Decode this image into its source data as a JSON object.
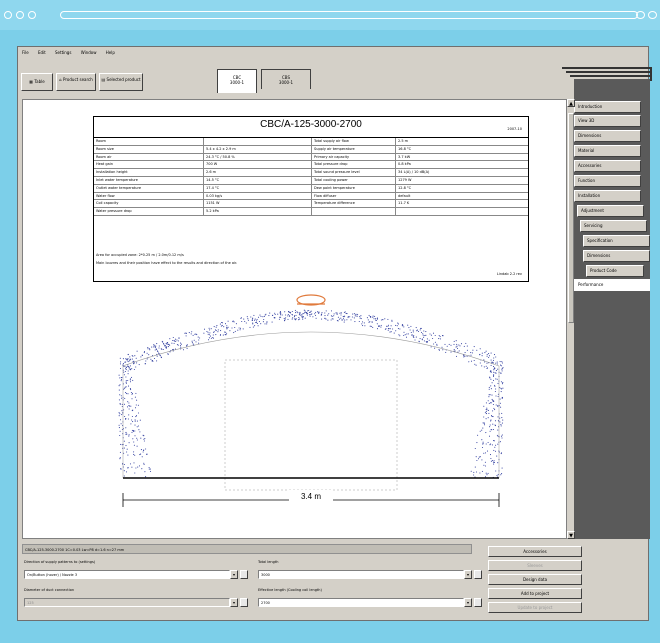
{
  "window": {
    "menu": [
      "File",
      "Edit",
      "Settings",
      "Window",
      "Help"
    ],
    "tool_buttons": [
      {
        "label": "Table",
        "icon": "table-icon"
      },
      {
        "label": "Product search",
        "icon": "house-icon"
      },
      {
        "label": "Selected product",
        "icon": "document-icon"
      }
    ],
    "doc_tabs": [
      {
        "line1": "CBC",
        "line2": "3000-1"
      },
      {
        "line1": "CBS",
        "line2": "3000-1"
      }
    ]
  },
  "side_tabs": [
    "Introduction",
    "View 3D",
    "Dimensions",
    "Material",
    "Accessories",
    "Function",
    "Installation",
    "Adjustment",
    "Servicing",
    "Specification",
    "Dimensions",
    "Product Code",
    "Performance"
  ],
  "document": {
    "title": "CBC/A-125-3000-2700",
    "title_right": "2007-10",
    "rows": [
      [
        "Room",
        "",
        "Total supply air flow",
        "2.5 m"
      ],
      [
        "Room size",
        "5.4 x 4.2 x 2.9 m",
        "Supply air temperature",
        "16.8 °C"
      ],
      [
        "Room air",
        "24.3 °C / 50.8 %",
        "Primary air capacity",
        "3.7 kW"
      ],
      [
        "Heat gain",
        "700 W",
        "Total pressure drop",
        "0.8 kPa"
      ],
      [
        "Installation height",
        "2.6 m",
        "Total sound pressure level",
        "34 L(A) / 10 dB(A)"
      ],
      [
        "Inlet water temperature",
        "14.5 °C",
        "Total cooling power",
        "1279 W"
      ],
      [
        "Outlet water temperature",
        "17.4 °C",
        "Dew point temperature",
        "12.8 °C"
      ],
      [
        "Water flow",
        "0.03 kg/s",
        "Flow diffuser",
        "default"
      ],
      [
        "Coil capacity",
        "1151 W",
        "Temperature difference",
        "11.7 K"
      ],
      [
        "Water pressure drop",
        "5.2 kPa",
        "",
        ""
      ]
    ],
    "notes": [
      "Area for occupied zone: 2*0.25 m / 2.0m/0.12 m/s",
      "Main louvres and their position have effect to the results and direction of the air."
    ],
    "stamp": "Lindab 2.2 rev",
    "dimension_label": "3.4 m"
  },
  "bottom": {
    "status": "CBC/A-125-3000-2700 1C=0.03 Lw=P8 d=1.6 n=27 mm",
    "label_direction": "Direction of supply patterns to (settings)",
    "value_direction": "On/Button (hover) / Nozzle 3",
    "label_length": "Total length",
    "value_length": "3000",
    "label_connection": "Diameter of duct connection",
    "value_connection": "125",
    "label_effective": "Effective length (Cooling coil length)",
    "value_effective": "2700",
    "actions": [
      {
        "label": "Accessories",
        "enabled": true
      },
      {
        "label": "Sleeves",
        "enabled": false
      },
      {
        "label": "Design data",
        "enabled": true
      },
      {
        "label": "Add to project",
        "enabled": true
      },
      {
        "label": "Update to project",
        "enabled": false
      }
    ]
  },
  "colors": {
    "background": "#7ccfe9",
    "sidepanel": "#5a5a5a",
    "accent_orange": "#e07a3c",
    "air_dots": "#3340a0"
  }
}
